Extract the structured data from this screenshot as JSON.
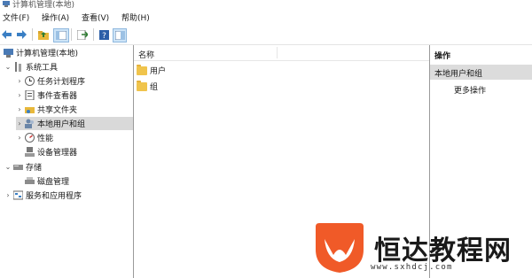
{
  "window": {
    "title": "计算机管理(本地)"
  },
  "menubar": {
    "items": [
      "文件(F)",
      "操作(A)",
      "查看(V)",
      "帮助(H)"
    ]
  },
  "toolbar": {
    "icons": [
      "back-arrow-icon",
      "forward-arrow-icon",
      "up-folder-icon",
      "show-hide-tree-icon",
      "export-list-icon",
      "help-icon",
      "properties-icon"
    ]
  },
  "tree": {
    "root": "计算机管理(本地)",
    "items": [
      {
        "label": "系统工具",
        "level": 1,
        "expanded": true
      },
      {
        "label": "任务计划程序",
        "level": 2
      },
      {
        "label": "事件查看器",
        "level": 2
      },
      {
        "label": "共享文件夹",
        "level": 2
      },
      {
        "label": "本地用户和组",
        "level": 2,
        "selected": true
      },
      {
        "label": "性能",
        "level": 2
      },
      {
        "label": "设备管理器",
        "level": 2
      },
      {
        "label": "存储",
        "level": 1,
        "expanded": true
      },
      {
        "label": "磁盘管理",
        "level": 2
      },
      {
        "label": "服务和应用程序",
        "level": 1
      }
    ]
  },
  "main": {
    "column_header": "名称",
    "rows": [
      "用户",
      "组"
    ]
  },
  "actions": {
    "header": "操作",
    "selected": "本地用户和组",
    "more": "更多操作"
  },
  "watermark": {
    "brand": "恒达教程网",
    "url": "www.sxhdcj.com"
  },
  "colors": {
    "logo_orange": "#f05a28",
    "selection_gray": "#d9d9d9"
  }
}
